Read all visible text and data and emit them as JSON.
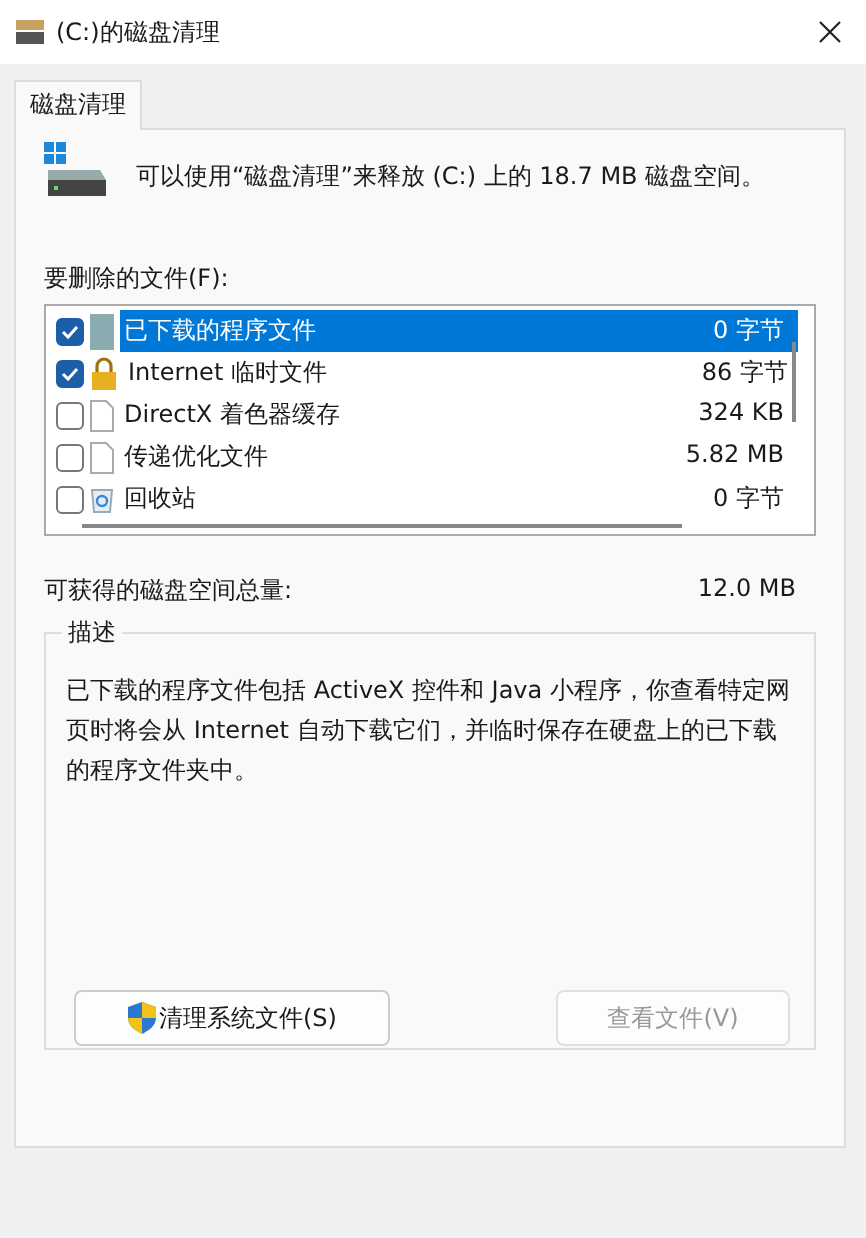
{
  "window": {
    "title": "(C:)的磁盘清理"
  },
  "tabs": [
    {
      "label": "磁盘清理",
      "selected": true
    }
  ],
  "intro": "可以使用“磁盘清理”来释放  (C:) 上的 18.7 MB 磁盘空间。",
  "files_label": "要删除的文件(F):",
  "files": [
    {
      "name": "已下载的程序文件",
      "size": "0 字节",
      "checked": true,
      "selected": true,
      "kind": "program"
    },
    {
      "name": "Internet 临时文件",
      "size": "86 字节",
      "checked": true,
      "selected": false,
      "kind": "lock"
    },
    {
      "name": "DirectX 着色器缓存",
      "size": "324 KB",
      "checked": false,
      "selected": false,
      "kind": "file"
    },
    {
      "name": "传递优化文件",
      "size": "5.82 MB",
      "checked": false,
      "selected": false,
      "kind": "file"
    },
    {
      "name": "回收站",
      "size": "0 字节",
      "checked": false,
      "selected": false,
      "kind": "recycle"
    }
  ],
  "total": {
    "label": "可获得的磁盘空间总量:",
    "value": "12.0 MB"
  },
  "description": {
    "title": "描述",
    "text": "已下载的程序文件包括 ActiveX 控件和 Java 小程序，你查看特定网页时将会从 Internet 自动下载它们，并临时保存在硬盘上的已下载的程序文件夹中。"
  },
  "buttons": [
    {
      "label": "清理系统文件(S)",
      "kind": "shield",
      "disabled": false
    },
    {
      "label": "查看文件(V)",
      "kind": "plain",
      "disabled": true
    }
  ]
}
